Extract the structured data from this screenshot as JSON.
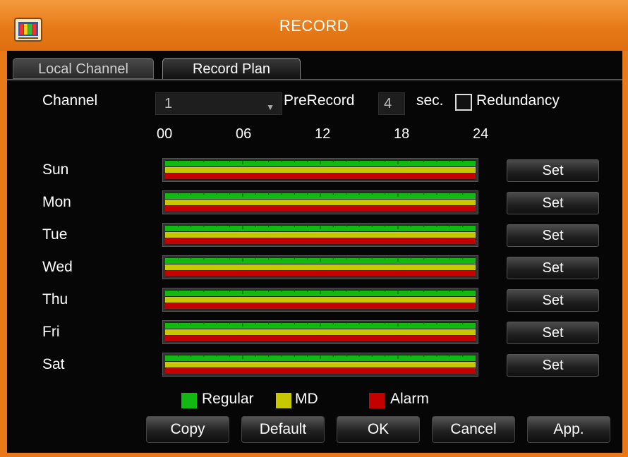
{
  "window": {
    "title": "RECORD"
  },
  "tabs": [
    {
      "label": "Local Channel",
      "active": false
    },
    {
      "label": "Record Plan",
      "active": true
    }
  ],
  "form": {
    "channel_label": "Channel",
    "channel_value": "1",
    "prerecord_label": "PreRecord",
    "prerecord_value": "4",
    "prerecord_unit": "sec.",
    "redundancy_label": "Redundancy",
    "redundancy_checked": false
  },
  "hours": [
    "00",
    "06",
    "12",
    "18",
    "24"
  ],
  "days": [
    {
      "label": "Sun",
      "set_label": "Set"
    },
    {
      "label": "Mon",
      "set_label": "Set"
    },
    {
      "label": "Tue",
      "set_label": "Set"
    },
    {
      "label": "Wed",
      "set_label": "Set"
    },
    {
      "label": "Thu",
      "set_label": "Set"
    },
    {
      "label": "Fri",
      "set_label": "Set"
    },
    {
      "label": "Sat",
      "set_label": "Set"
    }
  ],
  "schedule": {
    "regular": [
      [
        0,
        24
      ]
    ],
    "md": [
      [
        0,
        24
      ]
    ],
    "alarm": [
      [
        0,
        24
      ]
    ]
  },
  "legend": [
    {
      "label": "Regular",
      "color": "#11b911"
    },
    {
      "label": "MD",
      "color": "#c8c800"
    },
    {
      "label": "Alarm",
      "color": "#c40000"
    }
  ],
  "buttons": {
    "copy": "Copy",
    "default": "Default",
    "ok": "OK",
    "cancel": "Cancel",
    "apply": "App."
  },
  "colors": {
    "accent_orange": "#e8791a",
    "regular": "#11b911",
    "md": "#c8c800",
    "alarm": "#c40000"
  }
}
